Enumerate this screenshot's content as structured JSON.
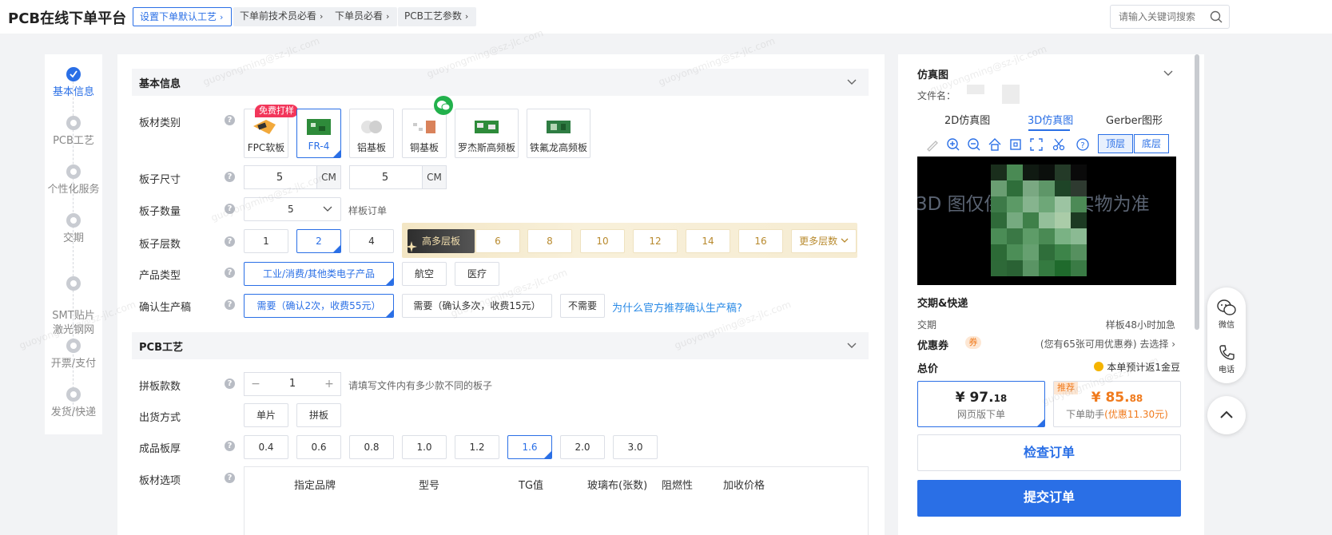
{
  "header": {
    "logo": "PCB在线下单平台",
    "links": [
      "设置下单默认工艺",
      "下单前技术员必看",
      "下单员必看",
      "PCB工艺参数"
    ],
    "search_placeholder": "请输入关键词搜索"
  },
  "steps": [
    "基本信息",
    "PCB工艺",
    "个性化服务",
    "交期",
    "SMT贴片\n激光钢网",
    "开票/支付",
    "发货/快递"
  ],
  "basic": {
    "title": "基本信息",
    "labels": {
      "material": "板材类别",
      "size": "板子尺寸",
      "qty": "板子数量",
      "layers": "板子层数",
      "product": "产品类型",
      "confirm": "确认生产稿"
    },
    "free_badge": "免费打样",
    "materials": [
      "FPC软板",
      "FR-4",
      "铝基板",
      "铜基板",
      "罗杰斯高频板",
      "铁氟龙高频板"
    ],
    "size_w": "5",
    "size_h": "5",
    "size_unit": "CM",
    "qty_value": "5",
    "qty_hint": "样板订单",
    "layers": [
      "1",
      "2",
      "4"
    ],
    "multi_layer_tag": "高多层板",
    "multi_layers": [
      "6",
      "8",
      "10",
      "12",
      "14",
      "16"
    ],
    "more_layers": "更多层数",
    "product_types": [
      "工业/消费/其他类电子产品",
      "航空",
      "医疗"
    ],
    "confirm_options": [
      "需要（确认2次，收费55元）",
      "需要（确认多次，收费15元）",
      "不需要"
    ],
    "confirm_link": "为什么官方推荐确认生产稿?"
  },
  "craft": {
    "title": "PCB工艺",
    "labels": {
      "panel": "拼板款数",
      "ship": "出货方式",
      "thick": "成品板厚",
      "option": "板材选项"
    },
    "panel_value": "1",
    "panel_hint": "请填写文件内有多少款不同的板子",
    "ship_options": [
      "单片",
      "拼板"
    ],
    "thickness": [
      "0.4",
      "0.6",
      "0.8",
      "1.0",
      "1.2",
      "1.6",
      "2.0",
      "3.0"
    ],
    "table_headers": [
      "指定品牌",
      "型号",
      "TG值",
      "玻璃布(张数)",
      "阻燃性",
      "加收价格"
    ]
  },
  "right": {
    "title": "仿真图",
    "file_label": "文件名：",
    "tabs": [
      "2D仿真图",
      "3D仿真图",
      "Gerber图形"
    ],
    "layer_buttons": [
      "顶层",
      "底层"
    ],
    "preview_text": "3D 图仅供参考，以实物为准",
    "delivery_title": "交期&快递",
    "delivery_label": "交期",
    "delivery_value": "样板48小时加急",
    "coupon_label": "优惠券",
    "coupon_tag": "券",
    "coupon_value": "(您有65张可用优惠券) 去选择",
    "total_label": "总价",
    "gold_note": "本单预计返1金豆",
    "price_web_main": "¥ 97.",
    "price_web_cents": "18",
    "price_web_sub": "网页版下单",
    "rec_tag": "推荐",
    "price_helper_main": "¥ 85.",
    "price_helper_cents": "88",
    "price_helper_sub": "下单助手",
    "price_helper_discount": "(优惠11.30元)",
    "check_btn": "检查订单",
    "submit_btn": "提交订单"
  },
  "float": {
    "wechat": "微信",
    "phone": "电话"
  },
  "colors": {
    "primary": "#2a6fe6",
    "gold": "#b88a2e",
    "price_orange": "#f07a1c"
  }
}
